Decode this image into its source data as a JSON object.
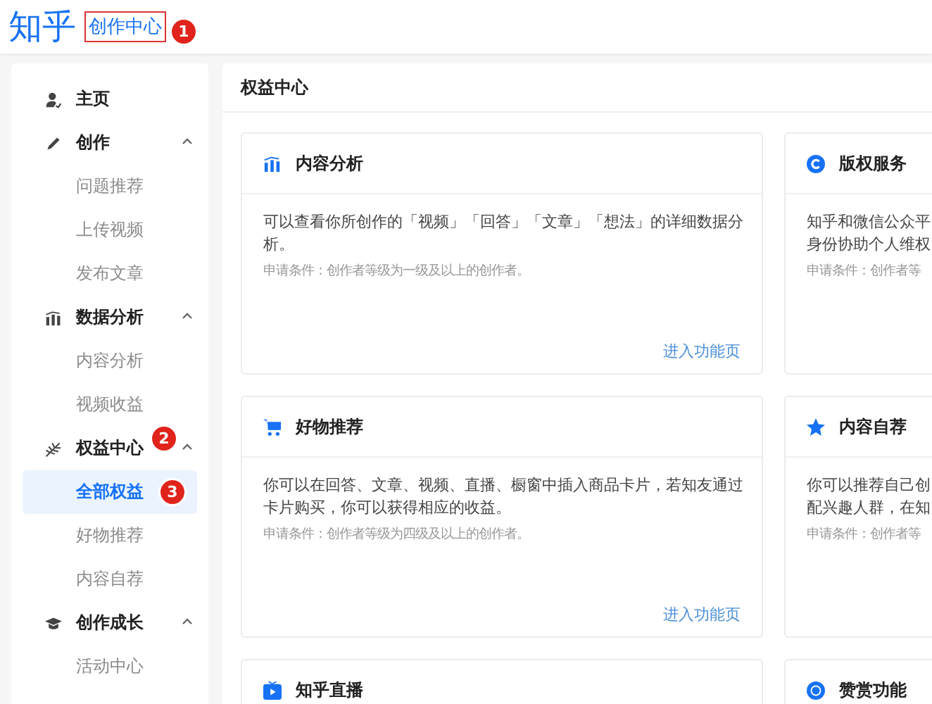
{
  "header": {
    "logo": "知乎",
    "title": "创作中心",
    "badge": "1"
  },
  "sidebar": {
    "items": [
      {
        "kind": "home",
        "label": "主页"
      },
      {
        "kind": "create",
        "label": "创作",
        "expanded": true,
        "children": [
          {
            "label": "问题推荐",
            "selected": false
          },
          {
            "label": "上传视频",
            "selected": false
          },
          {
            "label": "发布文章",
            "selected": false
          }
        ]
      },
      {
        "kind": "data",
        "label": "数据分析",
        "expanded": true,
        "children": [
          {
            "label": "内容分析",
            "selected": false
          },
          {
            "label": "视频收益",
            "selected": false
          }
        ]
      },
      {
        "kind": "rights",
        "label": "权益中心",
        "badge": "2",
        "expanded": true,
        "children": [
          {
            "label": "全部权益",
            "selected": true,
            "badge": "3"
          },
          {
            "label": "好物推荐",
            "selected": false
          },
          {
            "label": "内容自荐",
            "selected": false
          }
        ]
      },
      {
        "kind": "growth",
        "label": "创作成长",
        "expanded": true,
        "children": [
          {
            "label": "活动中心",
            "selected": false
          }
        ]
      }
    ]
  },
  "main": {
    "title": "权益中心",
    "cards": [
      {
        "kind": "analysis",
        "title": "内容分析",
        "description": "可以查看你所创作的「视频」「回答」「文章」「想法」的详细数据分析。",
        "condition": "申请条件：创作者等级为一级及以上的创作者。",
        "link": "进入功能页"
      },
      {
        "kind": "copyright",
        "title": "版权服务",
        "lines": [
          "知乎和微信公众平",
          "身份协助个人维权"
        ],
        "condition": "申请条件：创作者等"
      },
      {
        "kind": "goods",
        "title": "好物推荐",
        "description": "你可以在回答、文章、视频、直播、橱窗中插入商品卡片，若知友通过卡片购买，你可以获得相应的收益。",
        "condition": "申请条件：创作者等级为四级及以上的创作者。",
        "link": "进入功能页"
      },
      {
        "kind": "promote",
        "title": "内容自荐",
        "lines": [
          "你可以推荐自己创",
          "配兴趣人群，在知"
        ],
        "condition": "申请条件：创作者等"
      },
      {
        "kind": "live",
        "title": "知乎直播"
      },
      {
        "kind": "reward",
        "title": "赞赏功能"
      }
    ]
  }
}
